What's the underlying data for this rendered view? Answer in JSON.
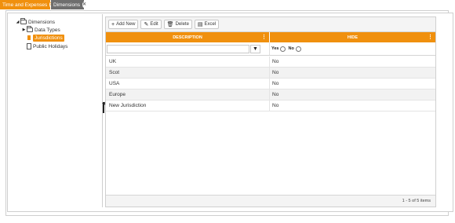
{
  "tabs": [
    {
      "label": "Time and Expenses",
      "close_icon": "close-icon"
    },
    {
      "label": "Dimensions",
      "close_icon": "close-icon"
    }
  ],
  "tree": {
    "root": {
      "label": "Dimensions",
      "icon": "folder-icon"
    },
    "children": [
      {
        "label": "Data Types",
        "icon": "folder-icon"
      },
      {
        "label": "Jurisdictions",
        "icon": "file-icon",
        "selected": true
      },
      {
        "label": "Public Holidays",
        "icon": "file-icon"
      }
    ]
  },
  "toolbar": {
    "add_label": "Add New",
    "edit_label": "Edit",
    "delete_label": "Delete",
    "excel_label": "Excel"
  },
  "grid": {
    "columns": [
      "DESCRIPTION",
      "HIDE"
    ],
    "filter": {
      "yes_label": "Yes",
      "no_label": "No"
    },
    "rows": [
      {
        "description": "UK",
        "hide": "No"
      },
      {
        "description": "Scot",
        "hide": "No"
      },
      {
        "description": "USA",
        "hide": "No"
      },
      {
        "description": "Europe",
        "hide": "No"
      },
      {
        "description": "New Jurisdiction",
        "hide": "No"
      }
    ],
    "pager_text": "1 - 5 of 5 items"
  },
  "colors": {
    "accent": "#f0900e",
    "inactive_tab": "#6e6e6e"
  }
}
